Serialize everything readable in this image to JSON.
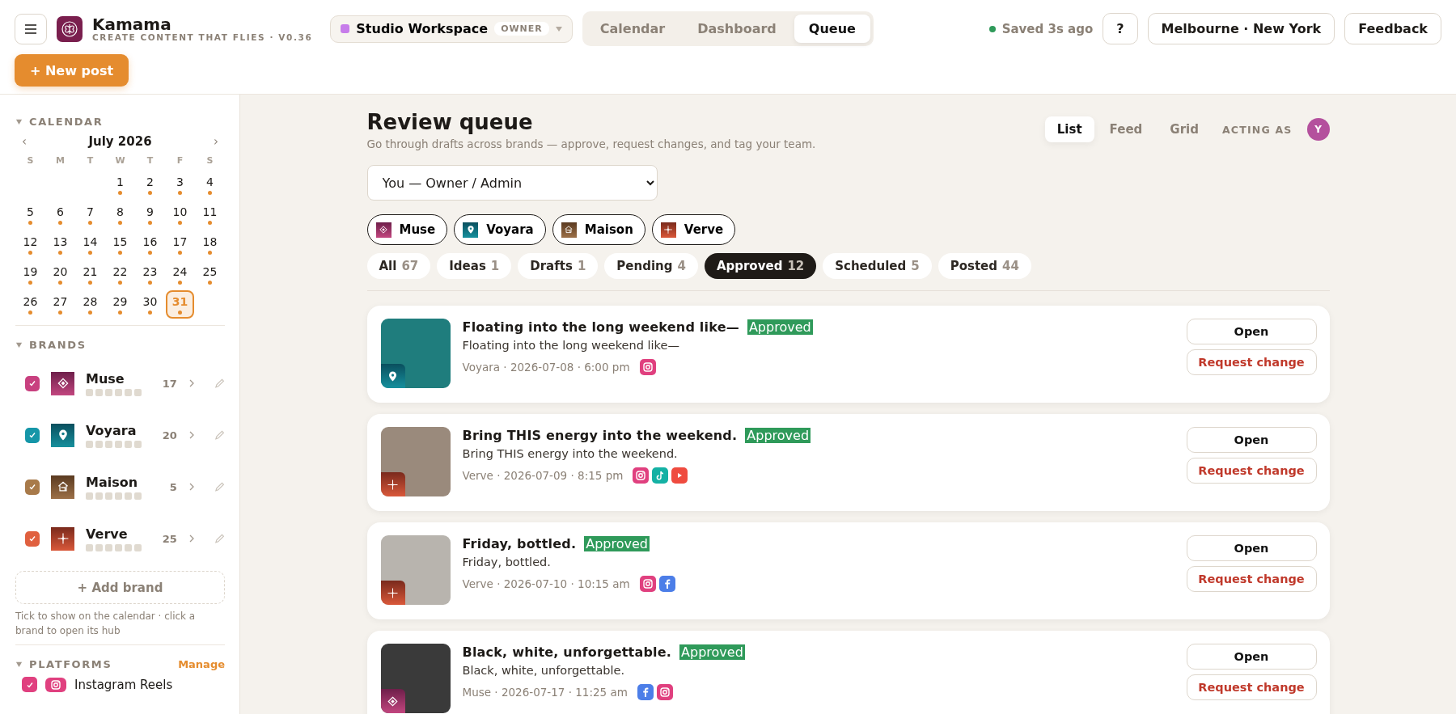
{
  "app": {
    "name": "Kamama",
    "tagline": "CREATE CONTENT THAT FLIES · V0.36",
    "new_post": "+ New post"
  },
  "workspace": {
    "name": "Studio Workspace",
    "role": "OWNER",
    "color": "#c77dea"
  },
  "nav_tabs": [
    {
      "label": "Calendar",
      "selected": false
    },
    {
      "label": "Dashboard",
      "selected": false
    },
    {
      "label": "Queue",
      "selected": true
    }
  ],
  "save_status": {
    "text": "Saved 3s ago",
    "saved": true
  },
  "header_buttons": {
    "help": "?",
    "timezones": "Melbourne · New York",
    "feedback": "Feedback"
  },
  "sidebar": {
    "calendar": {
      "title": "CALENDAR",
      "expanded": true,
      "month": "July 2026",
      "prev": "‹",
      "next": "›",
      "weekdays": [
        "S",
        "M",
        "T",
        "W",
        "T",
        "F",
        "S"
      ],
      "days": [
        {
          "kind": "blank"
        },
        {
          "kind": "blank"
        },
        {
          "kind": "blank"
        },
        {
          "kind": "day",
          "label": "1",
          "has_posts": true,
          "selected": false
        },
        {
          "kind": "day",
          "label": "2",
          "has_posts": true,
          "selected": false
        },
        {
          "kind": "day",
          "label": "3",
          "has_posts": true,
          "selected": false
        },
        {
          "kind": "day",
          "label": "4",
          "has_posts": true,
          "selected": false
        },
        {
          "kind": "day",
          "label": "5",
          "has_posts": true,
          "selected": false
        },
        {
          "kind": "day",
          "label": "6",
          "has_posts": true,
          "selected": false
        },
        {
          "kind": "day",
          "label": "7",
          "has_posts": true,
          "selected": false
        },
        {
          "kind": "day",
          "label": "8",
          "has_posts": true,
          "selected": false
        },
        {
          "kind": "day",
          "label": "9",
          "has_posts": true,
          "selected": false
        },
        {
          "kind": "day",
          "label": "10",
          "has_posts": true,
          "selected": false
        },
        {
          "kind": "day",
          "label": "11",
          "has_posts": true,
          "selected": false
        },
        {
          "kind": "day",
          "label": "12",
          "has_posts": true,
          "selected": false
        },
        {
          "kind": "day",
          "label": "13",
          "has_posts": true,
          "selected": false
        },
        {
          "kind": "day",
          "label": "14",
          "has_posts": true,
          "selected": false
        },
        {
          "kind": "day",
          "label": "15",
          "has_posts": true,
          "selected": false
        },
        {
          "kind": "day",
          "label": "16",
          "has_posts": true,
          "selected": false
        },
        {
          "kind": "day",
          "label": "17",
          "has_posts": true,
          "selected": false
        },
        {
          "kind": "day",
          "label": "18",
          "has_posts": true,
          "selected": false
        },
        {
          "kind": "day",
          "label": "19",
          "has_posts": true,
          "selected": false
        },
        {
          "kind": "day",
          "label": "20",
          "has_posts": true,
          "selected": false
        },
        {
          "kind": "day",
          "label": "21",
          "has_posts": true,
          "selected": false
        },
        {
          "kind": "day",
          "label": "22",
          "has_posts": true,
          "selected": false
        },
        {
          "kind": "day",
          "label": "23",
          "has_posts": true,
          "selected": false
        },
        {
          "kind": "day",
          "label": "24",
          "has_posts": true,
          "selected": false
        },
        {
          "kind": "day",
          "label": "25",
          "has_posts": true,
          "selected": false
        },
        {
          "kind": "day",
          "label": "26",
          "has_posts": true,
          "selected": false
        },
        {
          "kind": "day",
          "label": "27",
          "has_posts": true,
          "selected": false
        },
        {
          "kind": "day",
          "label": "28",
          "has_posts": true,
          "selected": false
        },
        {
          "kind": "day",
          "label": "29",
          "has_posts": true,
          "selected": false
        },
        {
          "kind": "day",
          "label": "30",
          "has_posts": true,
          "selected": false
        },
        {
          "kind": "day",
          "label": "31",
          "has_posts": true,
          "selected": true
        }
      ]
    },
    "brands": {
      "title": "BRANDS",
      "expanded": true,
      "add": "+ Add brand",
      "hint": "Tick to show on the calendar · click a brand to open its hub",
      "items": [
        {
          "name": "Muse",
          "count": "17",
          "checked": true,
          "color": "#c8407f",
          "kind": "diamond"
        },
        {
          "name": "Voyara",
          "count": "20",
          "checked": true,
          "color": "#1596a8",
          "kind": "pin"
        },
        {
          "name": "Maison",
          "count": "5",
          "checked": true,
          "color": "#a87a4a",
          "kind": "house"
        },
        {
          "name": "Verve",
          "count": "25",
          "checked": true,
          "color": "#e0603f",
          "kind": "sparkle"
        }
      ]
    },
    "platforms": {
      "title": "PLATFORMS",
      "expanded": true,
      "manage": "Manage",
      "items": [
        {
          "name": "Instagram Reels",
          "checked": true,
          "color": "#e0407f",
          "kind": "instagram"
        }
      ]
    }
  },
  "queue": {
    "title": "Review queue",
    "subtitle": "Go through drafts across brands — approve, request changes, and tag your team.",
    "views": [
      {
        "label": "List",
        "selected": true
      },
      {
        "label": "Feed",
        "selected": false
      },
      {
        "label": "Grid",
        "selected": false
      }
    ],
    "acting_as": {
      "label": "ACTING AS",
      "initial": "Y"
    },
    "role_select": {
      "value": "You — Owner / Admin"
    },
    "brand_filters": [
      {
        "name": "Muse",
        "kind": "diamond"
      },
      {
        "name": "Voyara",
        "kind": "pin"
      },
      {
        "name": "Maison",
        "kind": "house"
      },
      {
        "name": "Verve",
        "kind": "sparkle"
      }
    ],
    "status_filters": [
      {
        "label": "All",
        "count": "67",
        "selected": false
      },
      {
        "label": "Ideas",
        "count": "1",
        "selected": false
      },
      {
        "label": "Drafts",
        "count": "1",
        "selected": false
      },
      {
        "label": "Pending",
        "count": "4",
        "selected": false
      },
      {
        "label": "Approved",
        "count": "12",
        "selected": true
      },
      {
        "label": "Scheduled",
        "count": "5",
        "selected": false
      },
      {
        "label": "Posted",
        "count": "44",
        "selected": false
      }
    ],
    "posts": [
      {
        "title": "Floating into the long weekend like—",
        "status": "Approved",
        "caption": "Floating into the long weekend like—",
        "meta": "Voyara · 2026-07-08 · 6:00 pm",
        "kind": "pin",
        "platforms": [
          {
            "kind": "instagram"
          }
        ],
        "open": "Open",
        "request": "Request change"
      },
      {
        "title": "Bring THIS energy into the weekend.",
        "status": "Approved",
        "caption": "Bring THIS energy into the weekend.",
        "meta": "Verve · 2026-07-09 · 8:15 pm",
        "kind": "sparkle",
        "platforms": [
          {
            "kind": "instagram"
          },
          {
            "kind": "tiktok"
          },
          {
            "kind": "youtube"
          }
        ],
        "open": "Open",
        "request": "Request change"
      },
      {
        "title": "Friday, bottled.",
        "status": "Approved",
        "caption": "Friday, bottled.",
        "meta": "Verve · 2026-07-10 · 10:15 am",
        "kind": "sparkle",
        "platforms": [
          {
            "kind": "instagram"
          },
          {
            "kind": "facebook"
          }
        ],
        "open": "Open",
        "request": "Request change"
      },
      {
        "title": "Black, white, unforgettable.",
        "status": "Approved",
        "caption": "Black, white, unforgettable.",
        "meta": "Muse · 2026-07-17 · 11:25 am",
        "kind": "diamond",
        "platforms": [
          {
            "kind": "facebook"
          },
          {
            "kind": "instagram"
          }
        ],
        "open": "Open",
        "request": "Request change"
      }
    ]
  }
}
